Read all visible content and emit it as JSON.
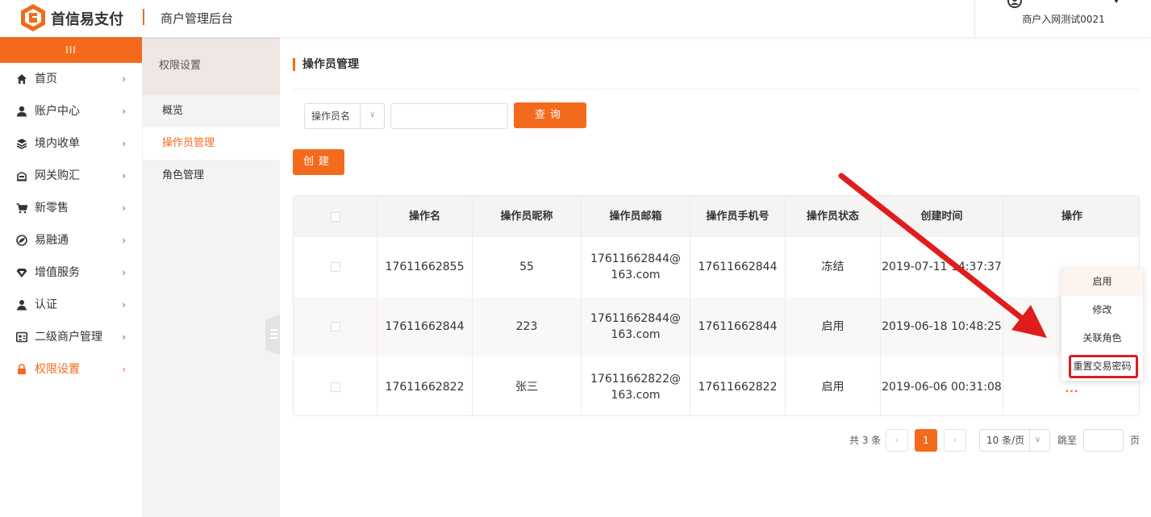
{
  "header": {
    "brand": "首信易支付",
    "subtitle": "商户管理后台",
    "user_name": "商户入网测试0021"
  },
  "sidebar": {
    "top_label": "III",
    "items": [
      {
        "label": "首页",
        "icon": "home-icon"
      },
      {
        "label": "账户中心",
        "icon": "user-icon"
      },
      {
        "label": "境内收单",
        "icon": "layers-icon"
      },
      {
        "label": "网关购汇",
        "icon": "bank-icon"
      },
      {
        "label": "新零售",
        "icon": "cart-icon"
      },
      {
        "label": "易融通",
        "icon": "leaf-icon"
      },
      {
        "label": "增值服务",
        "icon": "diamond-icon"
      },
      {
        "label": "认证",
        "icon": "person-icon"
      },
      {
        "label": "二级商户管理",
        "icon": "id-card-icon"
      },
      {
        "label": "权限设置",
        "icon": "lock-icon",
        "active": true
      }
    ]
  },
  "subnav": {
    "title": "权限设置",
    "items": [
      {
        "label": "概览"
      },
      {
        "label": "操作员管理",
        "active": true
      },
      {
        "label": "角色管理"
      }
    ]
  },
  "main": {
    "page_title": "操作员管理",
    "filter": {
      "field_label": "操作员名",
      "input_value": "",
      "query_label": "查询"
    },
    "create_label": "创建",
    "table": {
      "headers": [
        "操作名",
        "操作员昵称",
        "操作员邮箱",
        "操作员手机号",
        "操作员状态",
        "创建时间",
        "操作"
      ],
      "rows": [
        {
          "name": "17611662855",
          "nickname": "55",
          "email": "17611662844@163.com",
          "phone": "17611662844",
          "status": "冻结",
          "created": "2019-07-11 14:37:37",
          "action": ""
        },
        {
          "name": "17611662844",
          "nickname": "223",
          "email": "17611662844@163.com",
          "phone": "17611662844",
          "status": "启用",
          "created": "2019-06-18 10:48:25",
          "action": ""
        },
        {
          "name": "17611662822",
          "nickname": "张三",
          "email": "17611662822@163.com",
          "phone": "17611662822",
          "status": "启用",
          "created": "2019-06-06 00:31:08",
          "action": "..."
        }
      ]
    },
    "pagination": {
      "total": "共 3 条",
      "current_page": "1",
      "prev": "‹",
      "next": "›",
      "page_size": "10 条/页",
      "jump_label": "跳至",
      "jump_suffix": "页",
      "jump_value": ""
    }
  },
  "dropdown": {
    "items": [
      "启用",
      "修改",
      "关联角色",
      "重置交易密码"
    ]
  },
  "colors": {
    "accent": "#f46a1c",
    "highlight_border": "#d91f1f",
    "arrow": "#e01c1c"
  }
}
